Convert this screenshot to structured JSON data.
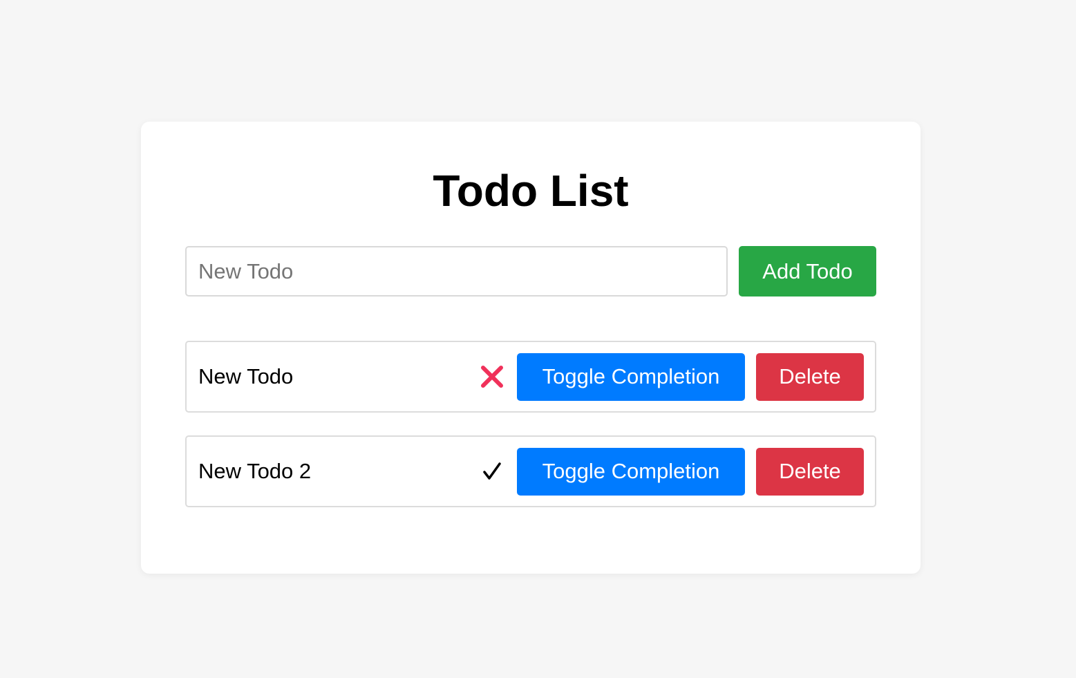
{
  "app": {
    "title": "Todo List"
  },
  "add_form": {
    "input_placeholder": "New Todo",
    "input_value": "",
    "add_button_label": "Add Todo"
  },
  "todos": [
    {
      "text": "New Todo",
      "status_icon": "cross-mark-icon",
      "completed": false,
      "toggle_label": "Toggle Completion",
      "delete_label": "Delete"
    },
    {
      "text": "New Todo 2",
      "status_icon": "check-mark-icon",
      "completed": true,
      "toggle_label": "Toggle Completion",
      "delete_label": "Delete"
    }
  ],
  "colors": {
    "page_background": "#f6f6f6",
    "card_background": "#ffffff",
    "add_button": "#28a745",
    "toggle_button": "#007bff",
    "delete_button": "#dc3545",
    "cross_icon": "#f0315a",
    "check_icon": "#000000"
  }
}
